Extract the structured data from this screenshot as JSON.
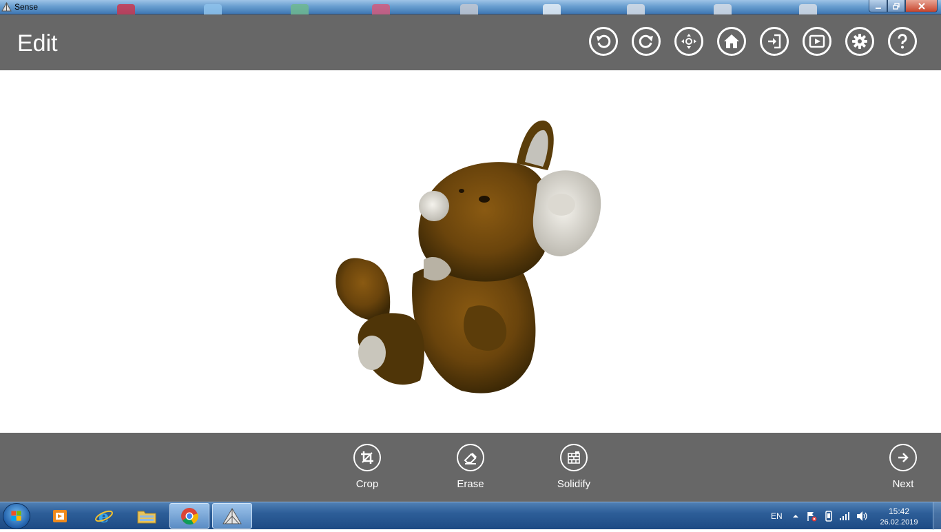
{
  "window": {
    "title": "Sense",
    "minimize_icon": "minimize-icon",
    "maximize_icon": "restore-icon",
    "close_icon": "close-icon"
  },
  "header": {
    "title": "Edit",
    "buttons": [
      {
        "name": "undo",
        "icon": "undo-icon"
      },
      {
        "name": "redo",
        "icon": "redo-icon"
      },
      {
        "name": "move",
        "icon": "move-icon"
      },
      {
        "name": "home",
        "icon": "home-icon"
      },
      {
        "name": "import",
        "icon": "import-icon"
      },
      {
        "name": "play",
        "icon": "play-icon"
      },
      {
        "name": "settings",
        "icon": "gear-icon"
      },
      {
        "name": "help",
        "icon": "help-icon"
      }
    ]
  },
  "toolbar": {
    "crop_label": "Crop",
    "erase_label": "Erase",
    "solidify_label": "Solidify",
    "next_label": "Next"
  },
  "taskbar": {
    "language": "EN",
    "time": "15:42",
    "date": "26.02.2019",
    "apps": [
      "start-orb-icon",
      "media-player-icon",
      "internet-explorer-icon",
      "file-explorer-icon",
      "chrome-icon",
      "sense-app-icon"
    ]
  },
  "colors": {
    "header_bg": "#676767",
    "toolbar_bg": "#676767",
    "viewport_bg": "#ffffff",
    "taskbar_bg": "#2d5e98"
  }
}
